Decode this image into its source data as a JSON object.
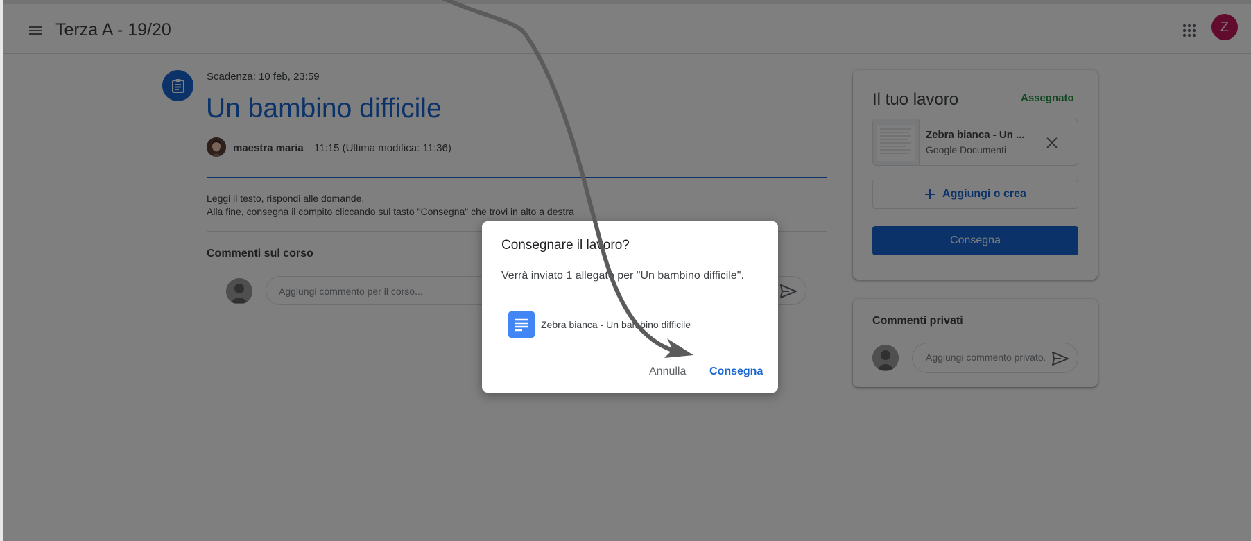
{
  "header": {
    "menu_icon": "hamburger-menu-icon",
    "class_title": "Terza A - 19/20",
    "apps_icon": "apps-grid-icon",
    "account_initial": "Z"
  },
  "assignment": {
    "icon": "assignment-clipboard-icon",
    "due": "Scadenza: 10 feb, 23:59",
    "title": "Un bambino difficile",
    "teacher": "maestra maria",
    "posted": "11:15 (Ultima modifica: 11:36)",
    "instructions": [
      "Leggi il testo, rispondi alle domande.",
      "Alla fine, consegna il compito cliccando sul tasto \"Consegna\" che trovi in alto a destra"
    ],
    "comments_heading": "Commenti sul corso",
    "comment_placeholder": "Aggiungi commento per il corso..."
  },
  "your_work": {
    "title": "Il tuo lavoro",
    "status": "Assegnato",
    "attachment": {
      "name": "Zebra bianca - Un ...",
      "type": "Google Documenti"
    },
    "add_label": "Aggiungi o crea",
    "turn_in_label": "Consegna"
  },
  "private_comments": {
    "heading": "Commenti privati",
    "placeholder": "Aggiungi commento privato..."
  },
  "dialog": {
    "title": "Consegnare il lavoro?",
    "body": "Verrà inviato 1 allegato per \"Un bambino difficile\".",
    "file_name": "Zebra bianca - Un bambino difficile",
    "cancel_label": "Annulla",
    "submit_label": "Consegna"
  },
  "colors": {
    "accent": "#1967d2",
    "status_green": "#1e8e3e",
    "avatar": "#c2185b",
    "overlay": "rgba(0,0,0,0.5)"
  }
}
